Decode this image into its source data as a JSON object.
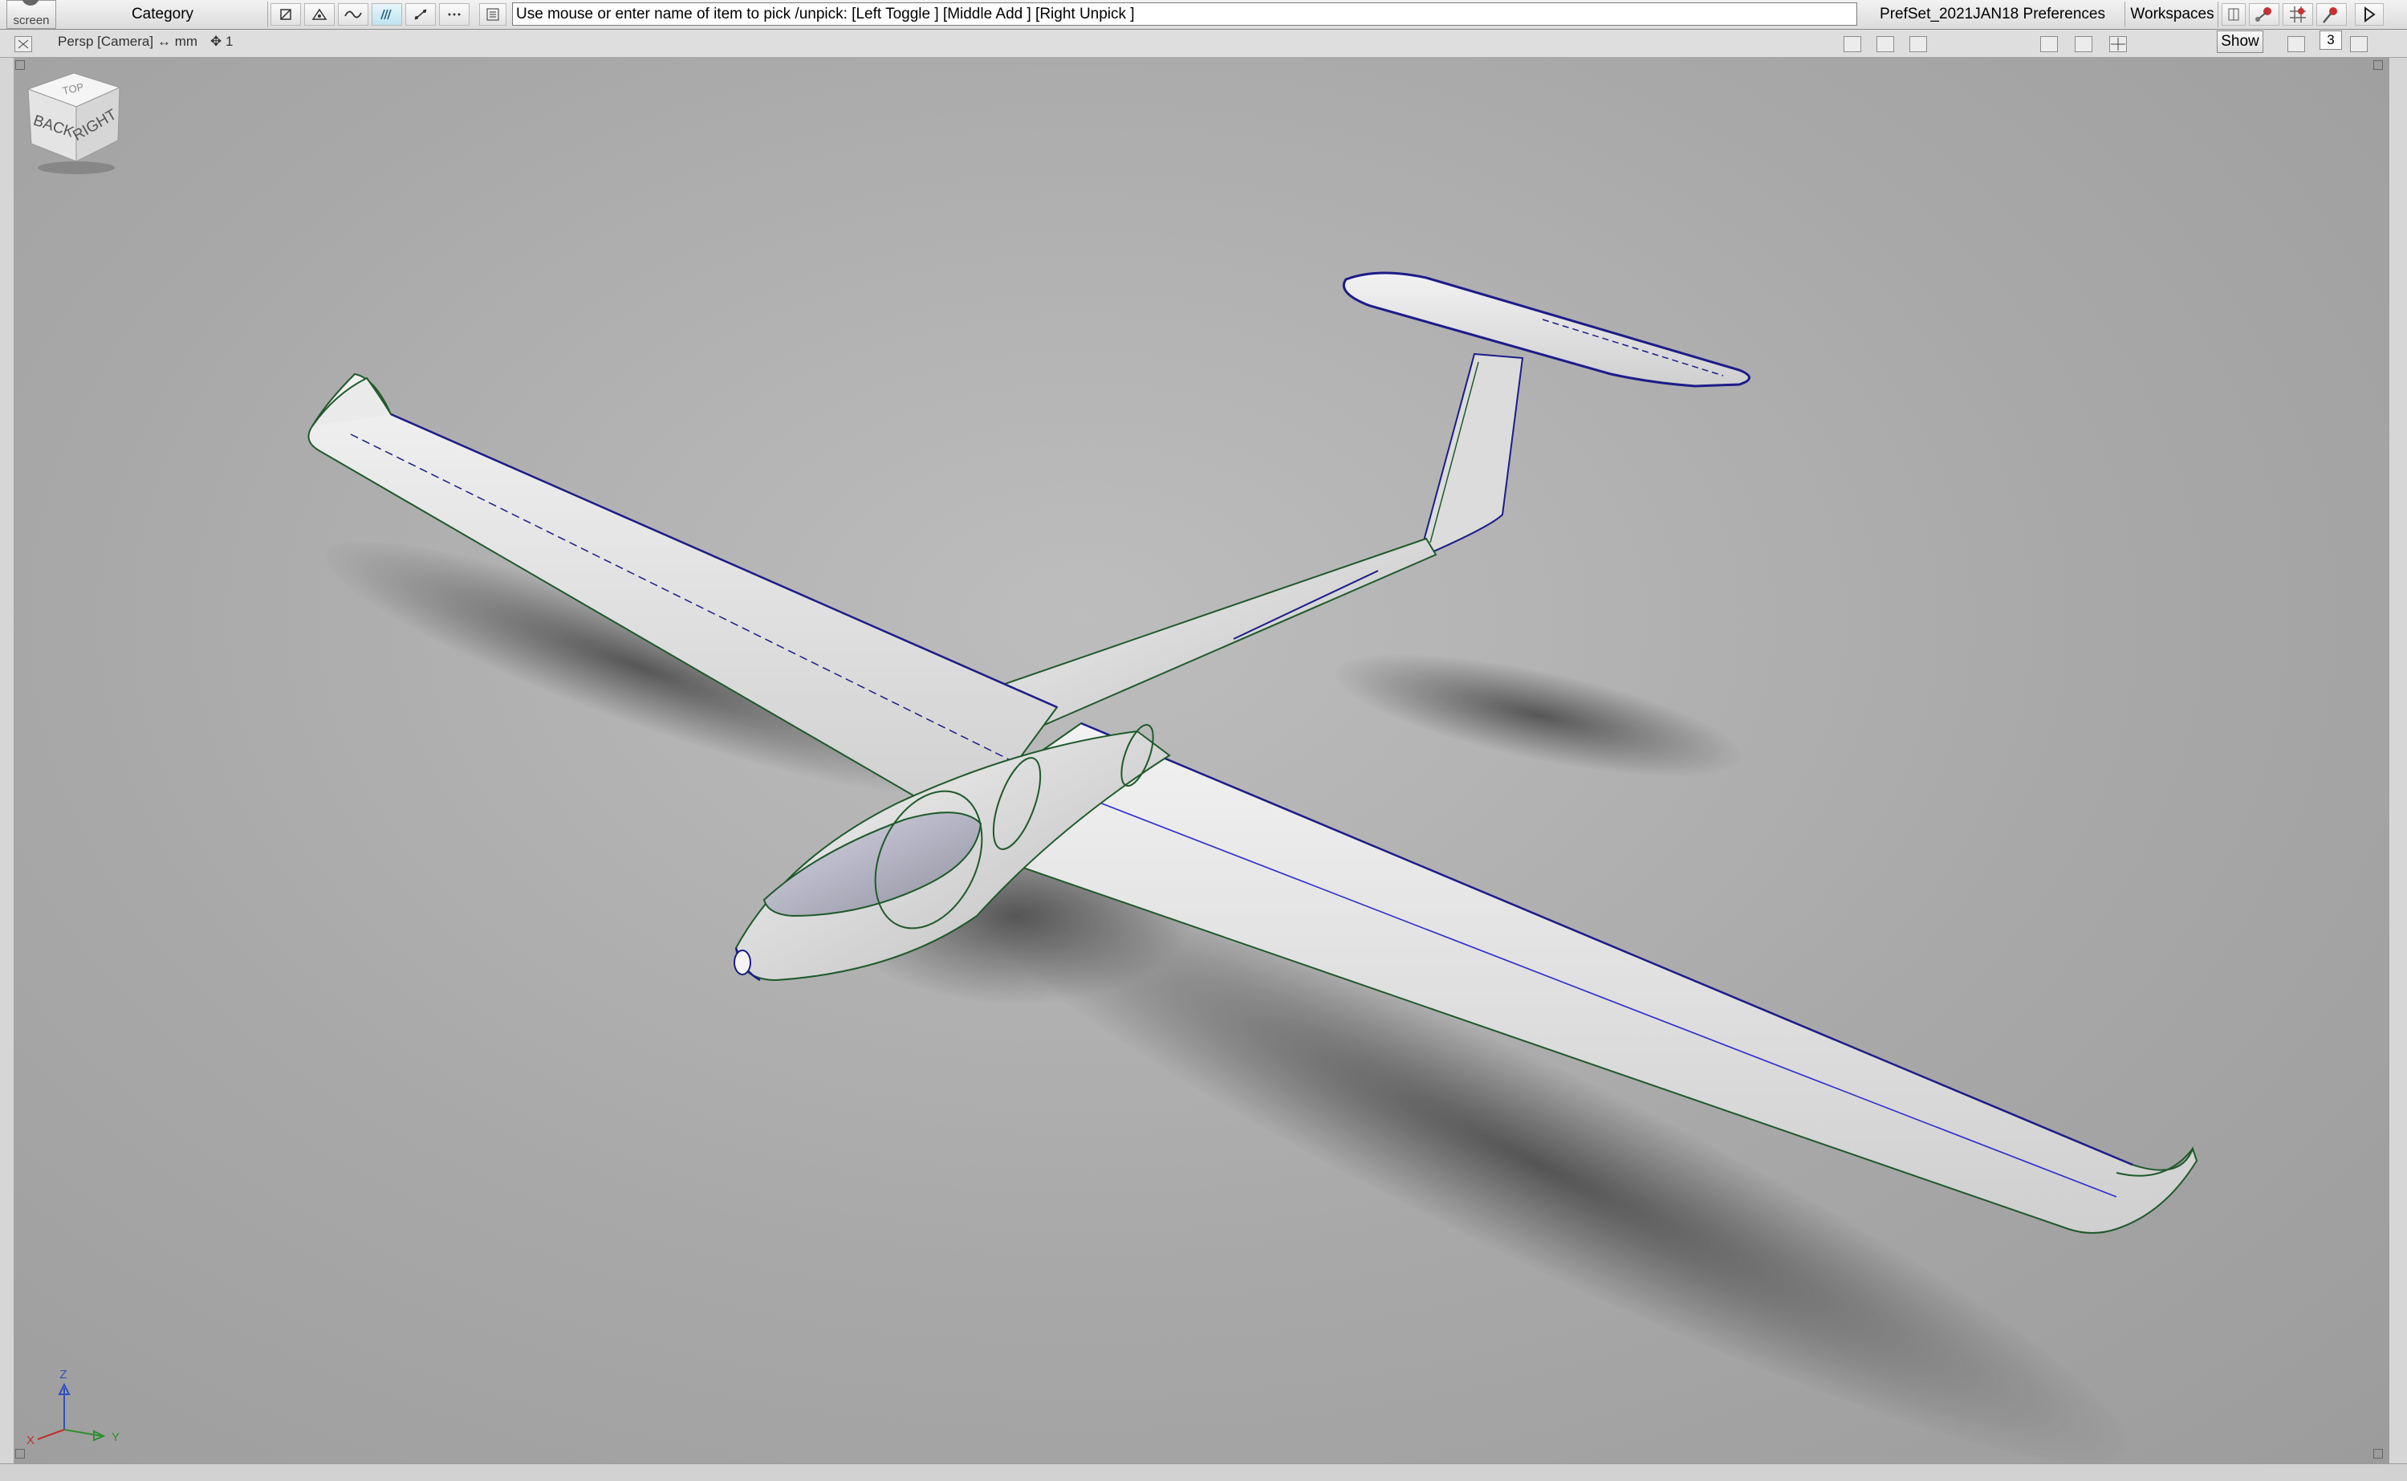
{
  "toolbar": {
    "screen_label": "screen",
    "category_label": "Category",
    "prompt_text": "Use mouse or enter name of item to pick /unpick: [Left Toggle ] [Middle Add ] [Right Unpick ]",
    "prefset_label": "PrefSet_2021JAN18 Preferences",
    "workspaces_label": "Workspaces"
  },
  "subbar": {
    "camera_label": "Persp [Camera]",
    "units_label": "↔ mm",
    "grid_label": "✥ 1",
    "show_label": "Show",
    "layout_number": "3"
  },
  "viewcube": {
    "top_label": "TOP",
    "back_label": "BACK",
    "right_label": "RIGHT"
  },
  "axis_triad": {
    "x_label": "X",
    "y_label": "Y",
    "z_label": "Z"
  },
  "colors": {
    "toolbar_bg": "#e6e6e6",
    "viewport_bg": "#a8a8a8",
    "model_surface": "#e4e4e4",
    "edge_green": "#1e5a2a",
    "edge_blue": "#1c1c8a",
    "axis_x": "#c03030",
    "axis_y": "#2f8f2f",
    "axis_z": "#3050c0"
  }
}
